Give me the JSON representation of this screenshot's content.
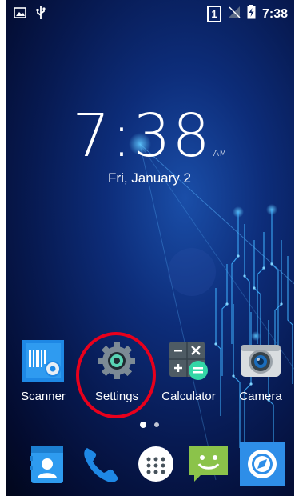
{
  "status_bar": {
    "time": "7:38",
    "sim_slot": "1",
    "icons": [
      "image-notification-icon",
      "usb-icon",
      "no-signal-icon",
      "battery-charging-icon"
    ]
  },
  "clock": {
    "time": "7:38",
    "ampm": "AM",
    "date": "Fri, January 2"
  },
  "apps": [
    {
      "label": "Scanner",
      "icon": "scanner-icon"
    },
    {
      "label": "Settings",
      "icon": "gear-icon"
    },
    {
      "label": "Calculator",
      "icon": "calculator-icon"
    },
    {
      "label": "Camera",
      "icon": "camera-icon"
    }
  ],
  "page_indicator": {
    "count": 2,
    "active": 1
  },
  "dock": [
    {
      "icon": "contacts-icon"
    },
    {
      "icon": "phone-icon"
    },
    {
      "icon": "all-apps-icon"
    },
    {
      "icon": "messaging-icon"
    },
    {
      "icon": "browser-icon"
    }
  ],
  "colors": {
    "highlight": "#e8001c",
    "wallpaper_glow": "#2aa8ff"
  }
}
